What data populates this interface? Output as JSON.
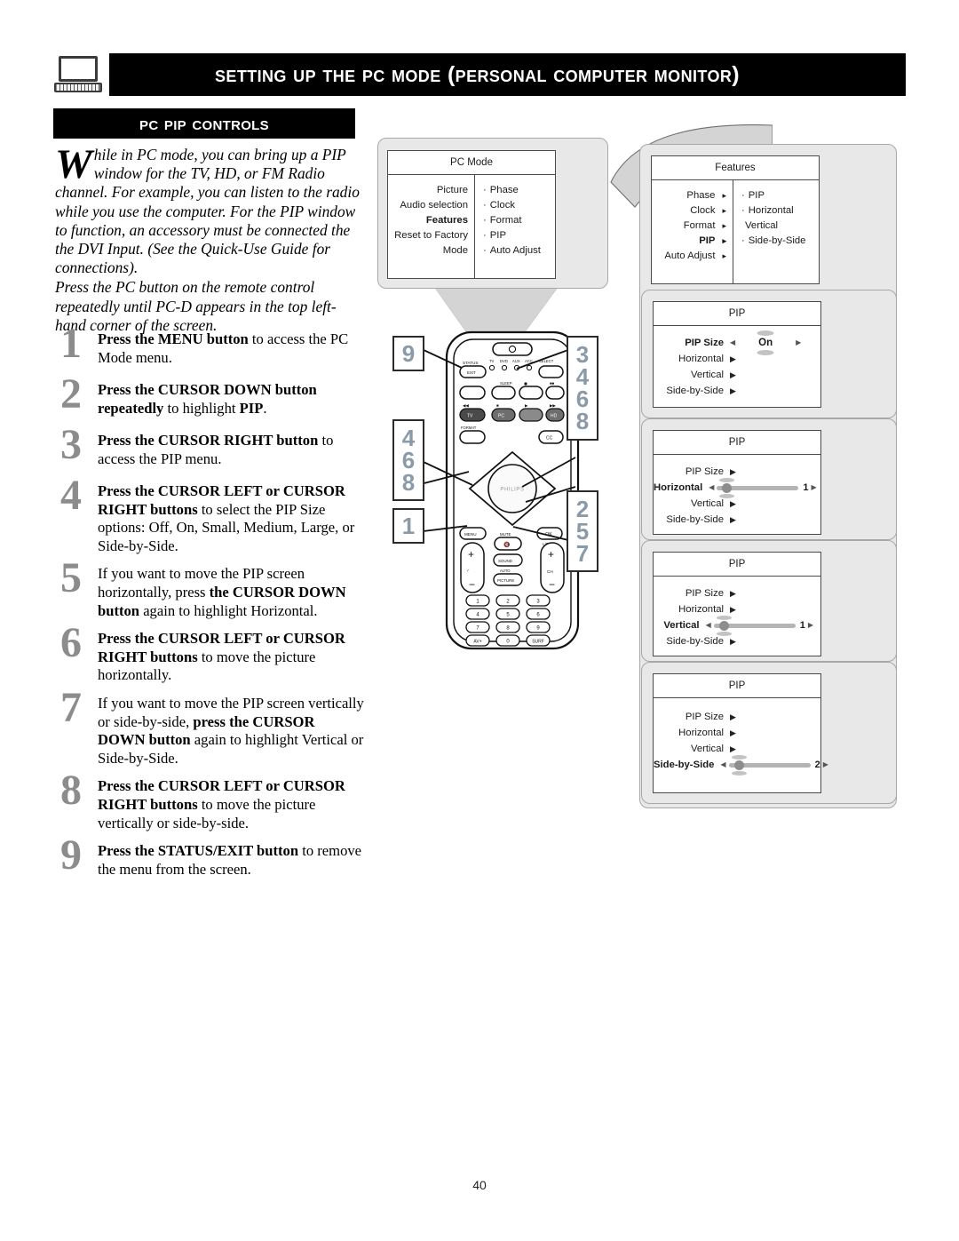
{
  "header": {
    "title": "Setting up the PC Mode (Personal Computer Monitor)",
    "icon": "computer-monitor-icon"
  },
  "section": {
    "title": "PC PIP Controls"
  },
  "intro": {
    "dropcap": "W",
    "paragraph1": "hile in PC mode, you can bring up a PIP window for the TV, HD, or FM Radio channel. For example, you can listen to the radio while you use the computer.  For the PIP window to function, an accessory must be connected the the DVI Input. (See the Quick-Use Guide for connections).",
    "paragraph2": "Press the PC button on the remote control repeatedly until PC-D appears in the top left-hand corner of the screen."
  },
  "steps": [
    {
      "num": "1",
      "bold1": "Press the MENU button",
      "rest1": " to access the PC Mode menu.",
      "bold2": "",
      "rest2": ""
    },
    {
      "num": "2",
      "bold1": "Press the CURSOR DOWN button repeatedly",
      "rest1": " to highlight ",
      "bold2": "PIP",
      "rest2": "."
    },
    {
      "num": "3",
      "bold1": "Press the CURSOR RIGHT button",
      "rest1": " to access the PIP menu.",
      "bold2": "",
      "rest2": ""
    },
    {
      "num": "4",
      "bold1": "Press the CURSOR LEFT or CURSOR RIGHT buttons",
      "rest1": " to select the PIP Size options: Off, On, Small, Medium, Large, or Side-by-Side.",
      "bold2": "",
      "rest2": ""
    },
    {
      "num": "5",
      "bold1": "",
      "rest1": "If you want to move the PIP screen horizontally, press ",
      "bold2": "the CURSOR DOWN button",
      "rest2": " again to highlight Horizontal."
    },
    {
      "num": "6",
      "bold1": "Press the CURSOR LEFT or CURSOR RIGHT buttons",
      "rest1": " to move the picture horizontally.",
      "bold2": "",
      "rest2": ""
    },
    {
      "num": "7",
      "bold1": "",
      "rest1": "If you want to move the PIP screen vertically or side-by-side, ",
      "bold2": "press the CURSOR DOWN button",
      "rest2": " again to highlight Vertical or Side-by-Side."
    },
    {
      "num": "8",
      "bold1": "Press the CURSOR LEFT or CURSOR RIGHT buttons",
      "rest1": " to move the picture vertically or side-by-side.",
      "bold2": "",
      "rest2": ""
    },
    {
      "num": "9",
      "bold1": "Press the STATUS/EXIT button",
      "rest1": " to remove the menu from the screen.",
      "bold2": "",
      "rest2": ""
    }
  ],
  "osd_pc_mode": {
    "title": "PC Mode",
    "left_items": [
      {
        "label": "Picture",
        "selected": false
      },
      {
        "label": "Audio selection",
        "selected": false
      },
      {
        "label": "Features",
        "selected": true
      },
      {
        "label": "Reset to Factory",
        "selected": false
      },
      {
        "label": "Mode",
        "selected": false
      }
    ],
    "right_items": [
      {
        "bullet": "·",
        "label": "Phase"
      },
      {
        "bullet": "·",
        "label": "Clock"
      },
      {
        "bullet": "·",
        "label": "Format"
      },
      {
        "bullet": "·",
        "label": "PIP"
      },
      {
        "bullet": "·",
        "label": "Auto Adjust"
      }
    ]
  },
  "osd_features": {
    "title": "Features",
    "left_items": [
      {
        "label": "Phase",
        "selected": false,
        "arrow": "▸"
      },
      {
        "label": "Clock",
        "selected": false,
        "arrow": "▸"
      },
      {
        "label": "Format",
        "selected": false,
        "arrow": "▸"
      },
      {
        "label": "PIP",
        "selected": true,
        "arrow": "▸"
      },
      {
        "label": "Auto Adjust",
        "selected": false,
        "arrow": "▸"
      }
    ],
    "right_items": [
      {
        "bullet": "·",
        "label": "PIP"
      },
      {
        "bullet": "·",
        "label": "Horizontal"
      },
      {
        "bullet": "",
        "label": "Vertical"
      },
      {
        "bullet": "·",
        "label": "Side-by-Side"
      }
    ]
  },
  "osd_pip_1": {
    "title": "PIP",
    "rows": [
      {
        "label": "PIP Size",
        "selected": true,
        "control": "value",
        "value": "On"
      },
      {
        "label": "Horizontal",
        "selected": false,
        "control": "arrow"
      },
      {
        "label": "Vertical",
        "selected": false,
        "control": "arrow"
      },
      {
        "label": "Side-by-Side",
        "selected": false,
        "control": "arrow"
      }
    ]
  },
  "osd_pip_2": {
    "title": "PIP",
    "rows": [
      {
        "label": "PIP Size",
        "selected": false,
        "control": "arrow"
      },
      {
        "label": "Horizontal",
        "selected": true,
        "control": "slider",
        "value": "1"
      },
      {
        "label": "Vertical",
        "selected": false,
        "control": "arrow"
      },
      {
        "label": "Side-by-Side",
        "selected": false,
        "control": "arrow"
      }
    ]
  },
  "osd_pip_3": {
    "title": "PIP",
    "rows": [
      {
        "label": "PIP Size",
        "selected": false,
        "control": "arrow"
      },
      {
        "label": "Horizontal",
        "selected": false,
        "control": "arrow"
      },
      {
        "label": "Vertical",
        "selected": true,
        "control": "slider",
        "value": "1"
      },
      {
        "label": "Side-by-Side",
        "selected": false,
        "control": "arrow"
      }
    ]
  },
  "osd_pip_4": {
    "title": "PIP",
    "rows": [
      {
        "label": "PIP Size",
        "selected": false,
        "control": "arrow"
      },
      {
        "label": "Horizontal",
        "selected": false,
        "control": "arrow"
      },
      {
        "label": "Vertical",
        "selected": false,
        "control": "arrow"
      },
      {
        "label": "Side-by-Side",
        "selected": true,
        "control": "slider",
        "value": "2"
      }
    ]
  },
  "callouts": {
    "exit_box": [
      "9"
    ],
    "cursor_left_box": [
      "4",
      "6",
      "8"
    ],
    "menu_box": [
      "1"
    ],
    "cursor_right_box": [
      "3",
      "4",
      "6",
      "8"
    ],
    "cursor_down_box": [
      "2",
      "5",
      "7"
    ]
  },
  "remote": {
    "brand": "PHILIPS",
    "labels": {
      "status_exit": "STATUS",
      "exit": "EXIT",
      "tv": "TV",
      "dvd": "DVD",
      "aux": "AUX",
      "acc": "ACC",
      "select": "SELECT",
      "sleep": "SLEEP",
      "format": "FORMAT",
      "cc": "CC",
      "menu": "MENU",
      "mute": "MUTE",
      "ok": "OK",
      "list": "LIST",
      "sound": "SOUND",
      "auto": "AUTO",
      "picture": "PICTURE",
      "ch": "CH",
      "pc": "PC",
      "hd": "HD",
      "av": "AV+",
      "surf": "SURF"
    },
    "keypad": [
      "1",
      "2",
      "3",
      "4",
      "5",
      "6",
      "7",
      "8",
      "9",
      "AV+",
      "0",
      "SURF"
    ]
  },
  "footer": {
    "page_number": "40"
  }
}
